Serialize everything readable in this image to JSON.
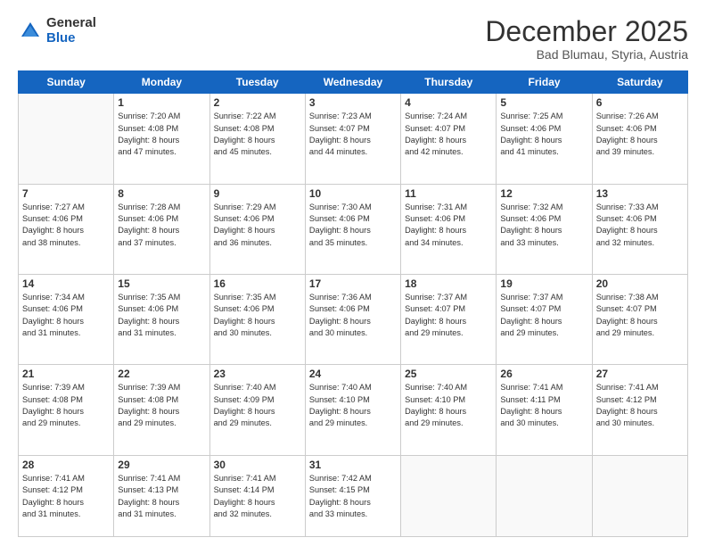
{
  "logo": {
    "general": "General",
    "blue": "Blue"
  },
  "header": {
    "month": "December 2025",
    "location": "Bad Blumau, Styria, Austria"
  },
  "weekdays": [
    "Sunday",
    "Monday",
    "Tuesday",
    "Wednesday",
    "Thursday",
    "Friday",
    "Saturday"
  ],
  "weeks": [
    [
      {
        "day": "",
        "info": ""
      },
      {
        "day": "1",
        "info": "Sunrise: 7:20 AM\nSunset: 4:08 PM\nDaylight: 8 hours\nand 47 minutes."
      },
      {
        "day": "2",
        "info": "Sunrise: 7:22 AM\nSunset: 4:08 PM\nDaylight: 8 hours\nand 45 minutes."
      },
      {
        "day": "3",
        "info": "Sunrise: 7:23 AM\nSunset: 4:07 PM\nDaylight: 8 hours\nand 44 minutes."
      },
      {
        "day": "4",
        "info": "Sunrise: 7:24 AM\nSunset: 4:07 PM\nDaylight: 8 hours\nand 42 minutes."
      },
      {
        "day": "5",
        "info": "Sunrise: 7:25 AM\nSunset: 4:06 PM\nDaylight: 8 hours\nand 41 minutes."
      },
      {
        "day": "6",
        "info": "Sunrise: 7:26 AM\nSunset: 4:06 PM\nDaylight: 8 hours\nand 39 minutes."
      }
    ],
    [
      {
        "day": "7",
        "info": "Sunrise: 7:27 AM\nSunset: 4:06 PM\nDaylight: 8 hours\nand 38 minutes."
      },
      {
        "day": "8",
        "info": "Sunrise: 7:28 AM\nSunset: 4:06 PM\nDaylight: 8 hours\nand 37 minutes."
      },
      {
        "day": "9",
        "info": "Sunrise: 7:29 AM\nSunset: 4:06 PM\nDaylight: 8 hours\nand 36 minutes."
      },
      {
        "day": "10",
        "info": "Sunrise: 7:30 AM\nSunset: 4:06 PM\nDaylight: 8 hours\nand 35 minutes."
      },
      {
        "day": "11",
        "info": "Sunrise: 7:31 AM\nSunset: 4:06 PM\nDaylight: 8 hours\nand 34 minutes."
      },
      {
        "day": "12",
        "info": "Sunrise: 7:32 AM\nSunset: 4:06 PM\nDaylight: 8 hours\nand 33 minutes."
      },
      {
        "day": "13",
        "info": "Sunrise: 7:33 AM\nSunset: 4:06 PM\nDaylight: 8 hours\nand 32 minutes."
      }
    ],
    [
      {
        "day": "14",
        "info": "Sunrise: 7:34 AM\nSunset: 4:06 PM\nDaylight: 8 hours\nand 31 minutes."
      },
      {
        "day": "15",
        "info": "Sunrise: 7:35 AM\nSunset: 4:06 PM\nDaylight: 8 hours\nand 31 minutes."
      },
      {
        "day": "16",
        "info": "Sunrise: 7:35 AM\nSunset: 4:06 PM\nDaylight: 8 hours\nand 30 minutes."
      },
      {
        "day": "17",
        "info": "Sunrise: 7:36 AM\nSunset: 4:06 PM\nDaylight: 8 hours\nand 30 minutes."
      },
      {
        "day": "18",
        "info": "Sunrise: 7:37 AM\nSunset: 4:07 PM\nDaylight: 8 hours\nand 29 minutes."
      },
      {
        "day": "19",
        "info": "Sunrise: 7:37 AM\nSunset: 4:07 PM\nDaylight: 8 hours\nand 29 minutes."
      },
      {
        "day": "20",
        "info": "Sunrise: 7:38 AM\nSunset: 4:07 PM\nDaylight: 8 hours\nand 29 minutes."
      }
    ],
    [
      {
        "day": "21",
        "info": "Sunrise: 7:39 AM\nSunset: 4:08 PM\nDaylight: 8 hours\nand 29 minutes."
      },
      {
        "day": "22",
        "info": "Sunrise: 7:39 AM\nSunset: 4:08 PM\nDaylight: 8 hours\nand 29 minutes."
      },
      {
        "day": "23",
        "info": "Sunrise: 7:40 AM\nSunset: 4:09 PM\nDaylight: 8 hours\nand 29 minutes."
      },
      {
        "day": "24",
        "info": "Sunrise: 7:40 AM\nSunset: 4:10 PM\nDaylight: 8 hours\nand 29 minutes."
      },
      {
        "day": "25",
        "info": "Sunrise: 7:40 AM\nSunset: 4:10 PM\nDaylight: 8 hours\nand 29 minutes."
      },
      {
        "day": "26",
        "info": "Sunrise: 7:41 AM\nSunset: 4:11 PM\nDaylight: 8 hours\nand 30 minutes."
      },
      {
        "day": "27",
        "info": "Sunrise: 7:41 AM\nSunset: 4:12 PM\nDaylight: 8 hours\nand 30 minutes."
      }
    ],
    [
      {
        "day": "28",
        "info": "Sunrise: 7:41 AM\nSunset: 4:12 PM\nDaylight: 8 hours\nand 31 minutes."
      },
      {
        "day": "29",
        "info": "Sunrise: 7:41 AM\nSunset: 4:13 PM\nDaylight: 8 hours\nand 31 minutes."
      },
      {
        "day": "30",
        "info": "Sunrise: 7:41 AM\nSunset: 4:14 PM\nDaylight: 8 hours\nand 32 minutes."
      },
      {
        "day": "31",
        "info": "Sunrise: 7:42 AM\nSunset: 4:15 PM\nDaylight: 8 hours\nand 33 minutes."
      },
      {
        "day": "",
        "info": ""
      },
      {
        "day": "",
        "info": ""
      },
      {
        "day": "",
        "info": ""
      }
    ]
  ]
}
